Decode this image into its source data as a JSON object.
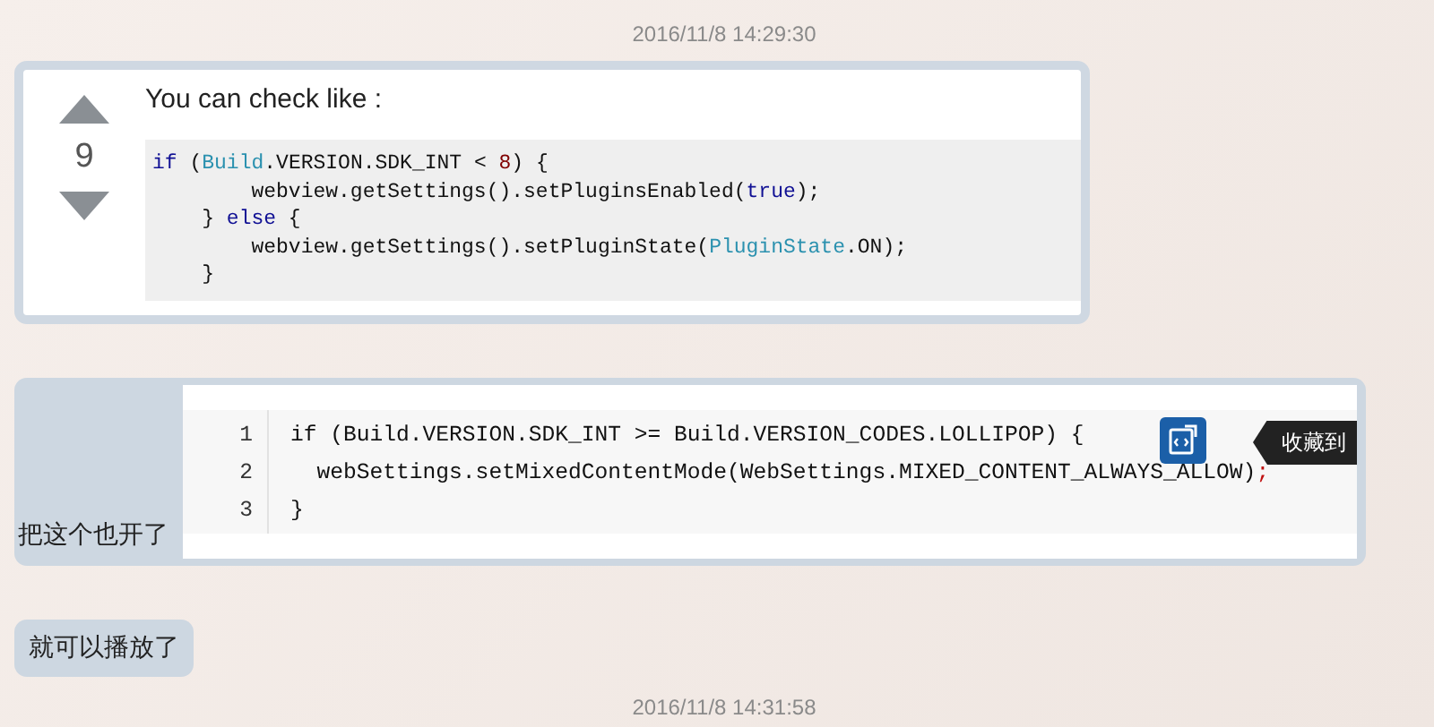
{
  "messages": [
    {
      "kind": "timestamp",
      "text": "2016/11/8 14:29:30"
    },
    {
      "kind": "answer",
      "votes": "9",
      "intro": "You can check like :",
      "code": [
        [
          {
            "text": "if",
            "kind": "kw"
          },
          {
            "text": " (",
            "kind": "p"
          },
          {
            "text": "Build",
            "kind": "type"
          },
          {
            "text": ".VERSION.SDK_INT < ",
            "kind": "p"
          },
          {
            "text": "8",
            "kind": "num"
          },
          {
            "text": ") {",
            "kind": "p"
          }
        ],
        [
          {
            "text": "        webview.getSettings().setPluginsEnabled(",
            "kind": "p"
          },
          {
            "text": "true",
            "kind": "kw"
          },
          {
            "text": ");",
            "kind": "p"
          }
        ],
        [
          {
            "text": "    } ",
            "kind": "p"
          },
          {
            "text": "else",
            "kind": "kw"
          },
          {
            "text": " {",
            "kind": "p"
          }
        ],
        [
          {
            "text": "        webview.getSettings().setPluginState(",
            "kind": "p"
          },
          {
            "text": "PluginState",
            "kind": "type"
          },
          {
            "text": ".ON);",
            "kind": "p"
          }
        ],
        [
          {
            "text": "    }",
            "kind": "p"
          }
        ]
      ]
    },
    {
      "kind": "snippet",
      "text": "把这个也开了",
      "tooltip": "收藏到",
      "lines": [
        {
          "number": "1",
          "tokens": [
            {
              "text": "if (Build.VERSION.SDK_INT >= Build.VERSION_CODES.LOLLIPOP) {",
              "kind": "p"
            }
          ]
        },
        {
          "number": "2",
          "tokens": [
            {
              "text": "  webSettings.setMixedContentMode(WebSettings.MIXED_CONTENT_ALWAYS_ALLOW)",
              "kind": "p"
            },
            {
              "text": ";",
              "kind": "punct"
            }
          ]
        },
        {
          "number": "3",
          "tokens": [
            {
              "text": "}",
              "kind": "p"
            }
          ]
        }
      ]
    },
    {
      "kind": "text",
      "text": "就可以播放了"
    },
    {
      "kind": "timestamp",
      "text": "2016/11/8 14:31:58"
    }
  ]
}
